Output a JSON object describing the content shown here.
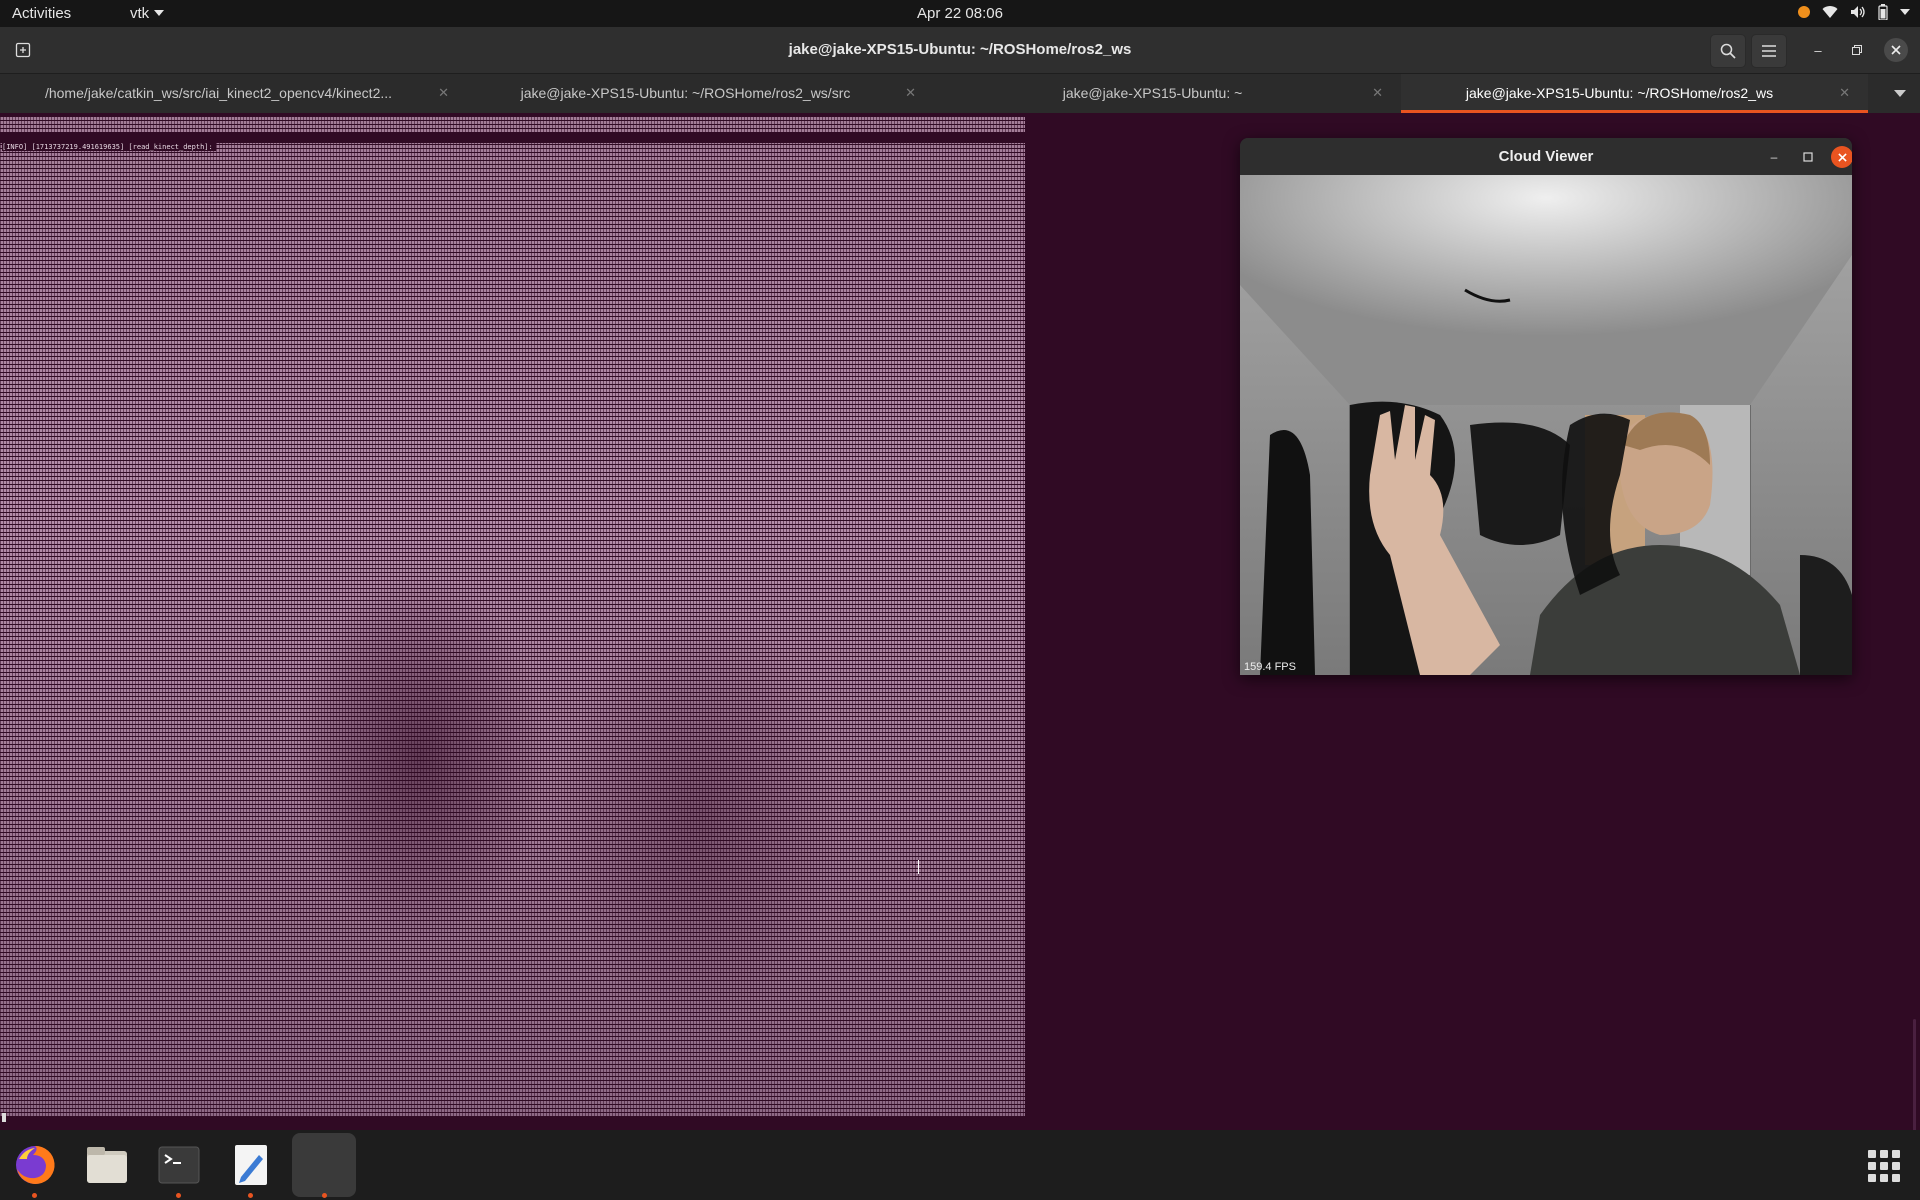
{
  "topbar": {
    "activities": "Activities",
    "app_name": "vtk",
    "clock": "Apr 22  08:06"
  },
  "terminal": {
    "window_title": "jake@jake-XPS15-Ubuntu: ~/ROSHome/ros2_ws",
    "tabs": [
      {
        "label": "/home/jake/catkin_ws/src/iai_kinect2_opencv4/kinect2..."
      },
      {
        "label": "jake@jake-XPS15-Ubuntu: ~/ROSHome/ros2_ws/src"
      },
      {
        "label": "jake@jake-XPS15-Ubuntu: ~"
      },
      {
        "label": "jake@jake-XPS15-Ubuntu: ~/ROSHome/ros2_ws"
      }
    ],
    "info_line": "[INFO] [1713737219.491619635] [read_kinect_depth]:"
  },
  "cloud_viewer": {
    "title": "Cloud Viewer",
    "fps": "159.4 FPS"
  },
  "colors": {
    "accent": "#e95420",
    "terminal_bg": "#300a24",
    "ascii_fg": "#b48daa"
  },
  "dock": {
    "items": [
      {
        "icon": "firefox-icon"
      },
      {
        "icon": "files-icon"
      },
      {
        "icon": "terminal-icon"
      },
      {
        "icon": "text-editor-icon"
      },
      {
        "icon": "vtk-window-icon"
      },
      {
        "icon": "show-applications-icon"
      }
    ]
  }
}
